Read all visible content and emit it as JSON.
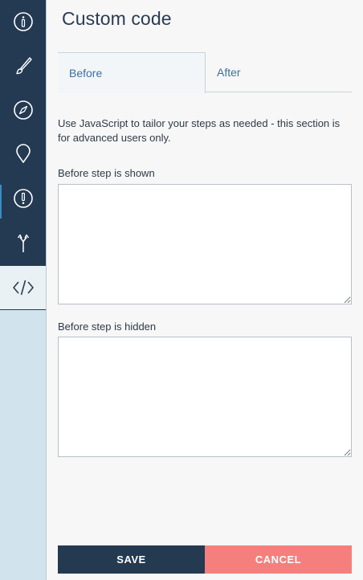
{
  "sidebar": {
    "items": [
      {
        "icon": "info-icon"
      },
      {
        "icon": "brush-icon"
      },
      {
        "icon": "compass-icon"
      },
      {
        "icon": "location-pin-icon"
      },
      {
        "icon": "alert-icon"
      },
      {
        "icon": "branch-arrow-icon"
      },
      {
        "icon": "code-icon",
        "active": true
      }
    ],
    "colors": {
      "dark": "#243a52",
      "light": "#d1e3ec",
      "accent": "#3a8cc4"
    }
  },
  "header": {
    "title": "Custom code"
  },
  "tabs": [
    {
      "label": "Before",
      "active": true
    },
    {
      "label": "After",
      "active": false
    }
  ],
  "content": {
    "description": "Use JavaScript to tailor your steps as needed - this section is for advanced users only.",
    "fields": [
      {
        "label": "Before step is shown",
        "value": ""
      },
      {
        "label": "Before step is hidden",
        "value": ""
      }
    ]
  },
  "actions": {
    "save_label": "SAVE",
    "cancel_label": "CANCEL",
    "save_color": "#233a50",
    "cancel_color": "#f57f7d"
  }
}
